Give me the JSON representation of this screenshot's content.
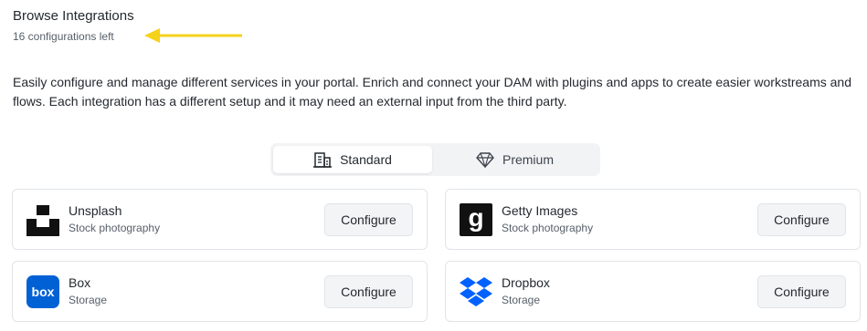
{
  "header": {
    "title": "Browse Integrations",
    "subtitle": "16 configurations left"
  },
  "description": "Easily configure and manage different services in your portal. Enrich and connect your DAM with plugins and apps to create easier workstreams and flows. Each integration has a different setup and it may need an external input from the third party.",
  "tabs": [
    {
      "label": "Standard",
      "icon": "building-icon",
      "active": true
    },
    {
      "label": "Premium",
      "icon": "diamond-icon",
      "active": false
    }
  ],
  "integrations": [
    {
      "name": "Unsplash",
      "category": "Stock photography",
      "button": "Configure",
      "icon": "unsplash-logo"
    },
    {
      "name": "Getty Images",
      "category": "Stock photography",
      "button": "Configure",
      "icon": "getty-images-logo"
    },
    {
      "name": "Box",
      "category": "Storage",
      "button": "Configure",
      "icon": "box-logo"
    },
    {
      "name": "Dropbox",
      "category": "Storage",
      "button": "Configure",
      "icon": "dropbox-logo"
    }
  ],
  "colors": {
    "annotation_arrow": "#f5d21b",
    "box_brand": "#0061d5",
    "dropbox_brand": "#0061fe"
  }
}
